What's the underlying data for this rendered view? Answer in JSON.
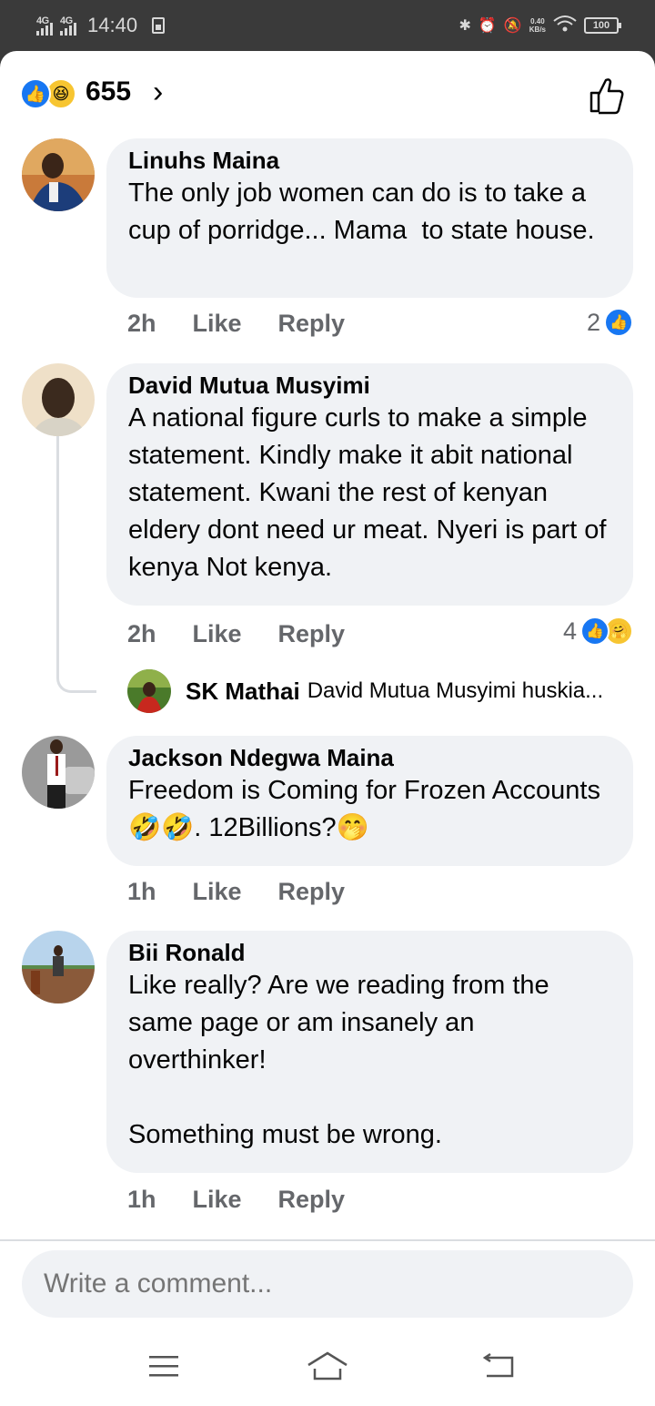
{
  "status_bar": {
    "network_1": "4G",
    "network_2": "4G",
    "time": "14:40",
    "speed_value": "0.40",
    "speed_unit": "KB/s",
    "battery": "100"
  },
  "header": {
    "reaction_count": "655",
    "reaction_icons": [
      "like-icon",
      "haha-icon"
    ]
  },
  "comments": [
    {
      "author": "Linuhs Maina",
      "text": "The only job women can do is to take a cup of porridge... Mama  to state house.",
      "time": "2h",
      "like_label": "Like",
      "reply_label": "Reply",
      "reaction_count": "2",
      "avatar_color": "#2c5a9a"
    },
    {
      "author": "David Mutua Musyimi",
      "text": "A national figure curls to make a simple statement. Kindly make it abit national statement. Kwani the rest of kenyan eldery dont need ur meat. Nyeri is part of kenya Not kenya.",
      "time": "2h",
      "like_label": "Like",
      "reply_label": "Reply",
      "reaction_count": "4",
      "avatar_color": "#e2c9a8",
      "reply_preview": {
        "author": "SK Mathai",
        "snippet": "David Mutua Musyimi huskia..."
      }
    },
    {
      "author": "Jackson Ndegwa Maina",
      "text": "Freedom is Coming for Frozen Accounts🤣🤣. 12Billions?🤭",
      "time": "1h",
      "like_label": "Like",
      "reply_label": "Reply",
      "avatar_color": "#6b6b6b"
    },
    {
      "author": "Bii Ronald",
      "text": "Like really? Are we reading from the same page or am insanely an overthinker!\n\nSomething must be wrong.",
      "time": "1h",
      "like_label": "Like",
      "reply_label": "Reply",
      "avatar_color": "#8fb5d8"
    }
  ],
  "composer": {
    "placeholder": "Write a comment..."
  },
  "colors": {
    "facebook_blue": "#1877f2",
    "bubble_bg": "#f0f2f5",
    "secondary_text": "#65676b"
  }
}
